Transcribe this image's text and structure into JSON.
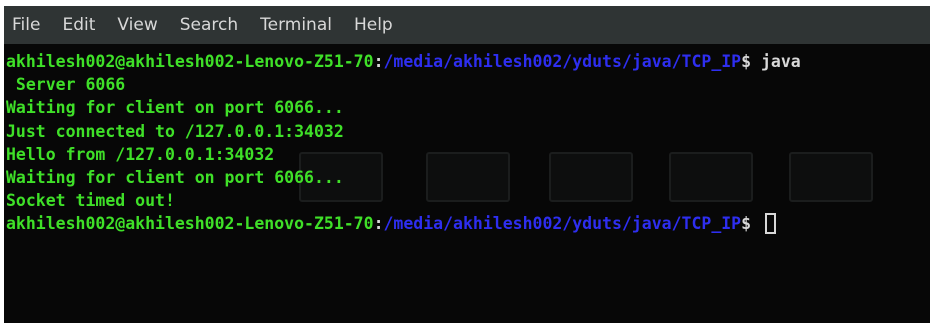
{
  "menubar": {
    "items": [
      {
        "label": "File"
      },
      {
        "label": "Edit"
      },
      {
        "label": "View"
      },
      {
        "label": "Search"
      },
      {
        "label": "Terminal"
      },
      {
        "label": "Help"
      }
    ]
  },
  "terminal": {
    "prompt_user": "akhilesh002@akhilesh002-Lenovo-Z51-70",
    "prompt_path": "/media/akhilesh002/yduts/java/TCP_IP",
    "command_1": "java",
    "output": [
      " Server 6066",
      "Waiting for client on port 6066...",
      "Just connected to /127.0.0.1:34032",
      "Hello from /127.0.0.1:34032",
      "Waiting for client on port 6066...",
      "Socket timed out!"
    ]
  },
  "colors": {
    "background": "#070707",
    "menubar": "#2f3434",
    "output_text": "#3fe028",
    "path_text": "#2e2ef0",
    "plain_text": "#d8d8d8"
  }
}
